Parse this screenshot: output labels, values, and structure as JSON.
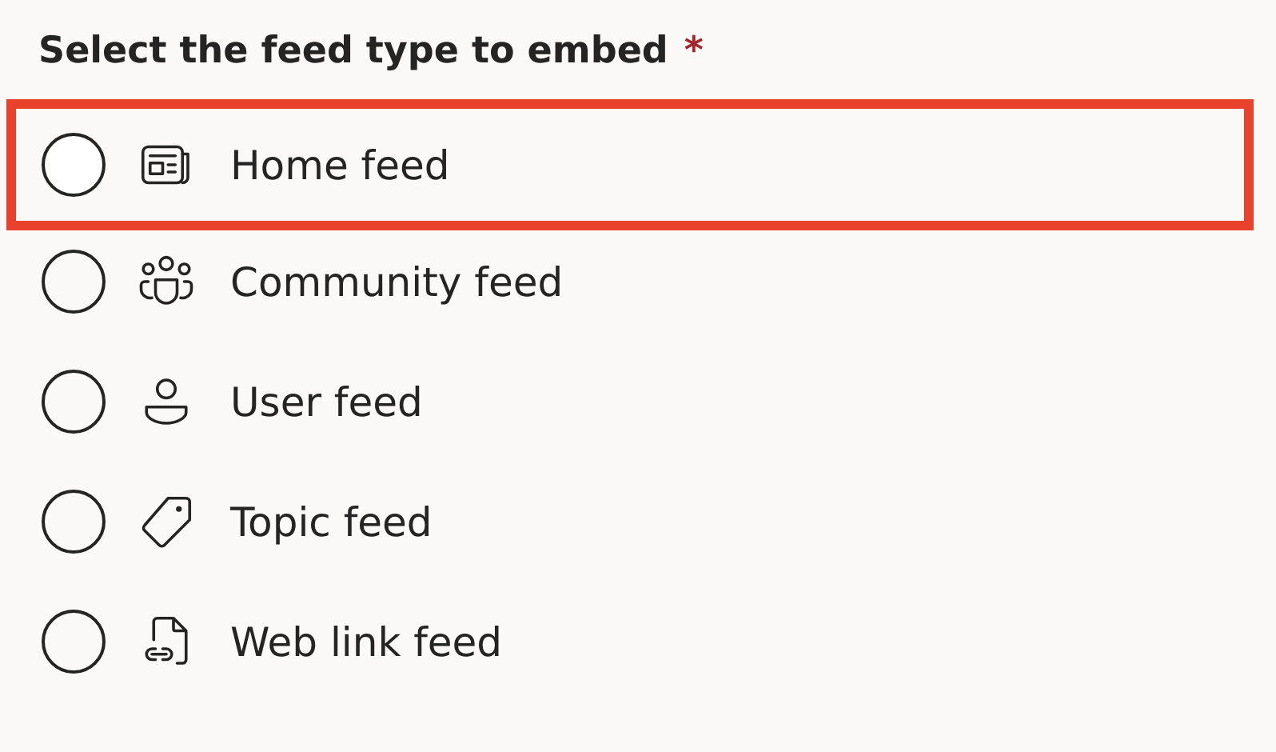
{
  "question": {
    "label": "Select the feed type to embed",
    "required_mark": "*"
  },
  "options": [
    {
      "label": "Home feed",
      "kind": "news",
      "selected": false,
      "highlighted": true
    },
    {
      "label": "Community feed",
      "kind": "people",
      "selected": false,
      "highlighted": false
    },
    {
      "label": "User feed",
      "kind": "person",
      "selected": false,
      "highlighted": false
    },
    {
      "label": "Topic feed",
      "kind": "tag",
      "selected": false,
      "highlighted": false
    },
    {
      "label": "Web link feed",
      "kind": "link-doc",
      "selected": false,
      "highlighted": false
    }
  ]
}
